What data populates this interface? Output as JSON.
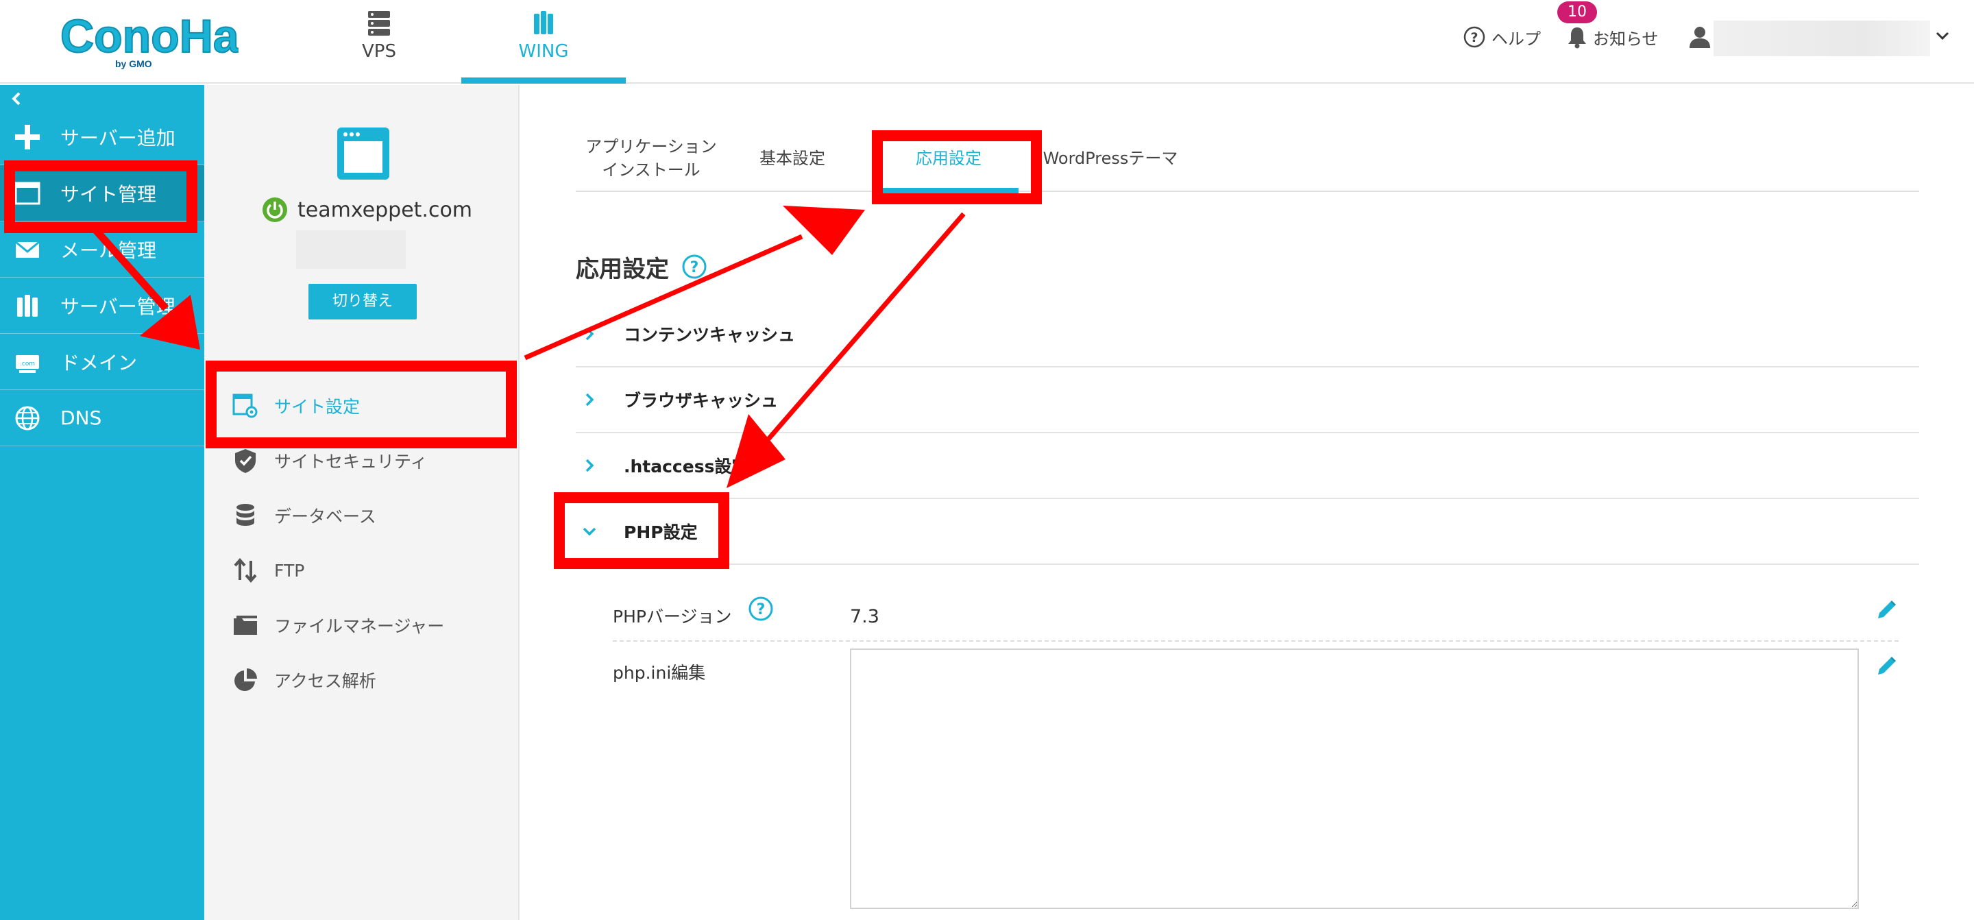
{
  "header": {
    "nav": [
      {
        "label": "VPS",
        "icon": "server-stack-icon"
      },
      {
        "label": "WING",
        "icon": "wing-server-icon"
      }
    ],
    "help_label": "ヘルプ",
    "news_label": "お知らせ",
    "news_badge": "10"
  },
  "sidebar": {
    "items": [
      {
        "label": "サーバー追加",
        "icon": "plus-icon"
      },
      {
        "label": "サイト管理",
        "icon": "window-icon"
      },
      {
        "label": "メール管理",
        "icon": "mail-icon"
      },
      {
        "label": "サーバー管理",
        "icon": "server-icon"
      },
      {
        "label": "ドメイン",
        "icon": "domain-icon"
      },
      {
        "label": "DNS",
        "icon": "globe-icon"
      }
    ]
  },
  "site": {
    "name": "teamxeppet.com",
    "switch_label": "切り替え"
  },
  "site_menu": [
    {
      "label": "サイト設定",
      "icon": "site-settings-icon"
    },
    {
      "label": "サイトセキュリティ",
      "icon": "shield-icon"
    },
    {
      "label": "データベース",
      "icon": "database-icon"
    },
    {
      "label": "FTP",
      "icon": "transfer-arrows-icon"
    },
    {
      "label": "ファイルマネージャー",
      "icon": "folder-icon"
    },
    {
      "label": "アクセス解析",
      "icon": "pie-chart-icon"
    }
  ],
  "tabs": {
    "app_line1": "アプリケーション",
    "app_line2": "インストール",
    "basic": "基本設定",
    "advanced": "応用設定",
    "wp_theme": "WordPressテーマ"
  },
  "section": {
    "title": "応用設定",
    "accordions": [
      {
        "label": "コンテンツキャッシュ",
        "expanded": false
      },
      {
        "label": "ブラウザキャッシュ",
        "expanded": false
      },
      {
        "label": ".htaccess設定",
        "expanded": false
      },
      {
        "label": "PHP設定",
        "expanded": true
      }
    ],
    "php_version_label": "PHPバージョン",
    "php_version_value": "7.3",
    "php_ini_label": "php.ini編集",
    "php_ini_value": ""
  },
  "colors": {
    "brand": "#1ab2d5",
    "brand_dark": "#1294b1",
    "badge": "#cf1c71",
    "highlight": "#ff0000",
    "power_green": "#5aad2e"
  }
}
